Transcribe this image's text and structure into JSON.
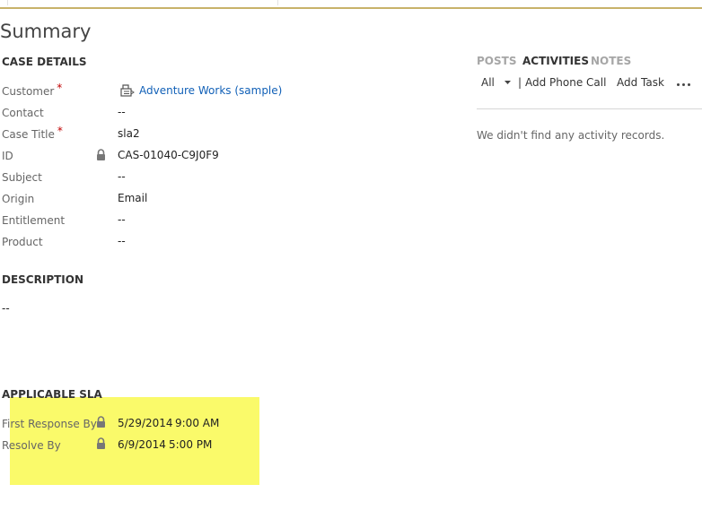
{
  "page": {
    "title": "Summary"
  },
  "case_details": {
    "heading": "CASE DETAILS",
    "fields": [
      {
        "label": "Customer",
        "value": "Adventure Works (sample)",
        "required": "*"
      },
      {
        "label": "Contact",
        "value": "--"
      },
      {
        "label": "Case Title",
        "value": "sla2",
        "required": "*"
      },
      {
        "label": "ID",
        "value": "CAS-01040-C9J0F9",
        "locked": true
      },
      {
        "label": "Subject",
        "value": "--"
      },
      {
        "label": "Origin",
        "value": "Email"
      },
      {
        "label": "Entitlement",
        "value": "--"
      },
      {
        "label": "Product",
        "value": "--"
      }
    ]
  },
  "description": {
    "heading": "DESCRIPTION",
    "value": "--"
  },
  "applicable_sla": {
    "heading": "APPLICABLE SLA",
    "highlight_color": "#fafa6a",
    "fields": [
      {
        "label": "First Response By",
        "date": "5/29/2014",
        "time": "9:00 AM",
        "locked": true
      },
      {
        "label": "Resolve By",
        "date": "6/9/2014",
        "time": "5:00 PM",
        "locked": true
      }
    ]
  },
  "social_pane": {
    "tabs": [
      {
        "label": "POSTS",
        "active": false
      },
      {
        "label": "ACTIVITIES",
        "active": true
      },
      {
        "label": "NOTES",
        "active": false
      }
    ],
    "filter_value": "All",
    "separator": "|",
    "add_phone_call": "Add Phone Call",
    "add_task": "Add Task",
    "empty_message": "We didn't find any activity records."
  },
  "colors": {
    "accent_rule": "#c8b26a",
    "link": "#1160b7",
    "required": "#c00000"
  },
  "icons": [
    "account-icon",
    "lock-icon",
    "chevron-down-icon",
    "more-icon"
  ]
}
